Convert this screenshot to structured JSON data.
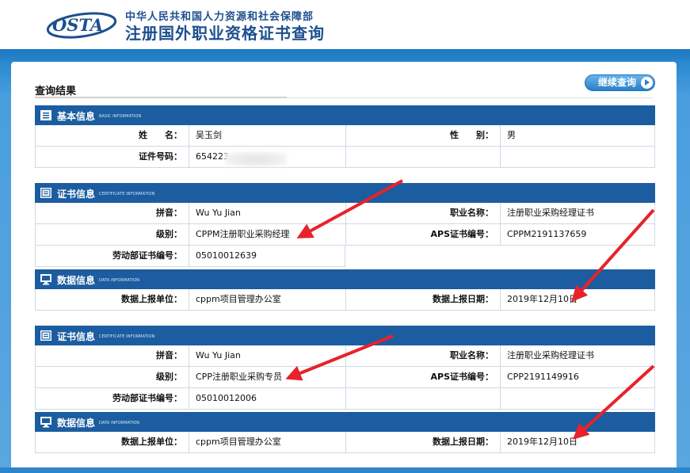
{
  "header": {
    "logo_text": "OSTA",
    "ministry": "中华人民共和国人力资源和社会保障部",
    "site_title": "注册国外职业资格证书查询"
  },
  "result": {
    "title": "查询结果",
    "continue_label": "继续查询"
  },
  "basic": {
    "title": "基本信息",
    "title_en": "BASIC INFORMATION",
    "name_label": "姓　　名：",
    "name_value": "吴玉剑",
    "gender_label": "性　　别：",
    "gender_value": "男",
    "id_label": "证件号码：",
    "id_value": "654223"
  },
  "certificates": [
    {
      "title": "证书信息",
      "title_en": "CERTIFICATE INFORMATION",
      "pinyin_label": "拼音：",
      "pinyin_value": "Wu Yu Jian",
      "job_label": "职业名称：",
      "job_value": "注册职业采购经理证书",
      "level_label": "级别：",
      "level_value": "CPPM注册职业采购经理",
      "aps_label": "APS证书编号：",
      "aps_value": "CPPM2191137659",
      "labor_label": "劳动部证书编号：",
      "labor_value": "05010012639",
      "data_title": "数据信息",
      "data_title_en": "DATA INFORMATION",
      "unit_label": "数据上报单位：",
      "unit_value": "cppm项目管理办公室",
      "date_label": "数据上报日期：",
      "date_value": "2019年12月10日"
    },
    {
      "title": "证书信息",
      "title_en": "CERTIFICATE INFORMATION",
      "pinyin_label": "拼音：",
      "pinyin_value": "Wu Yu Jian",
      "job_label": "职业名称：",
      "job_value": "注册职业采购经理证书",
      "level_label": "级别：",
      "level_value": "CPP注册职业采购专员",
      "aps_label": "APS证书编号：",
      "aps_value": "CPP2191149916",
      "labor_label": "劳动部证书编号：",
      "labor_value": "05010012006",
      "data_title": "数据信息",
      "data_title_en": "DATA INFORMATION",
      "unit_label": "数据上报单位：",
      "unit_value": "cppm项目管理办公室",
      "date_label": "数据上报日期：",
      "date_value": "2019年12月10日"
    }
  ],
  "colors": {
    "section_bar": "#1b5da0",
    "band": "#2b8ad0",
    "annotation_arrow": "#e8222a"
  }
}
